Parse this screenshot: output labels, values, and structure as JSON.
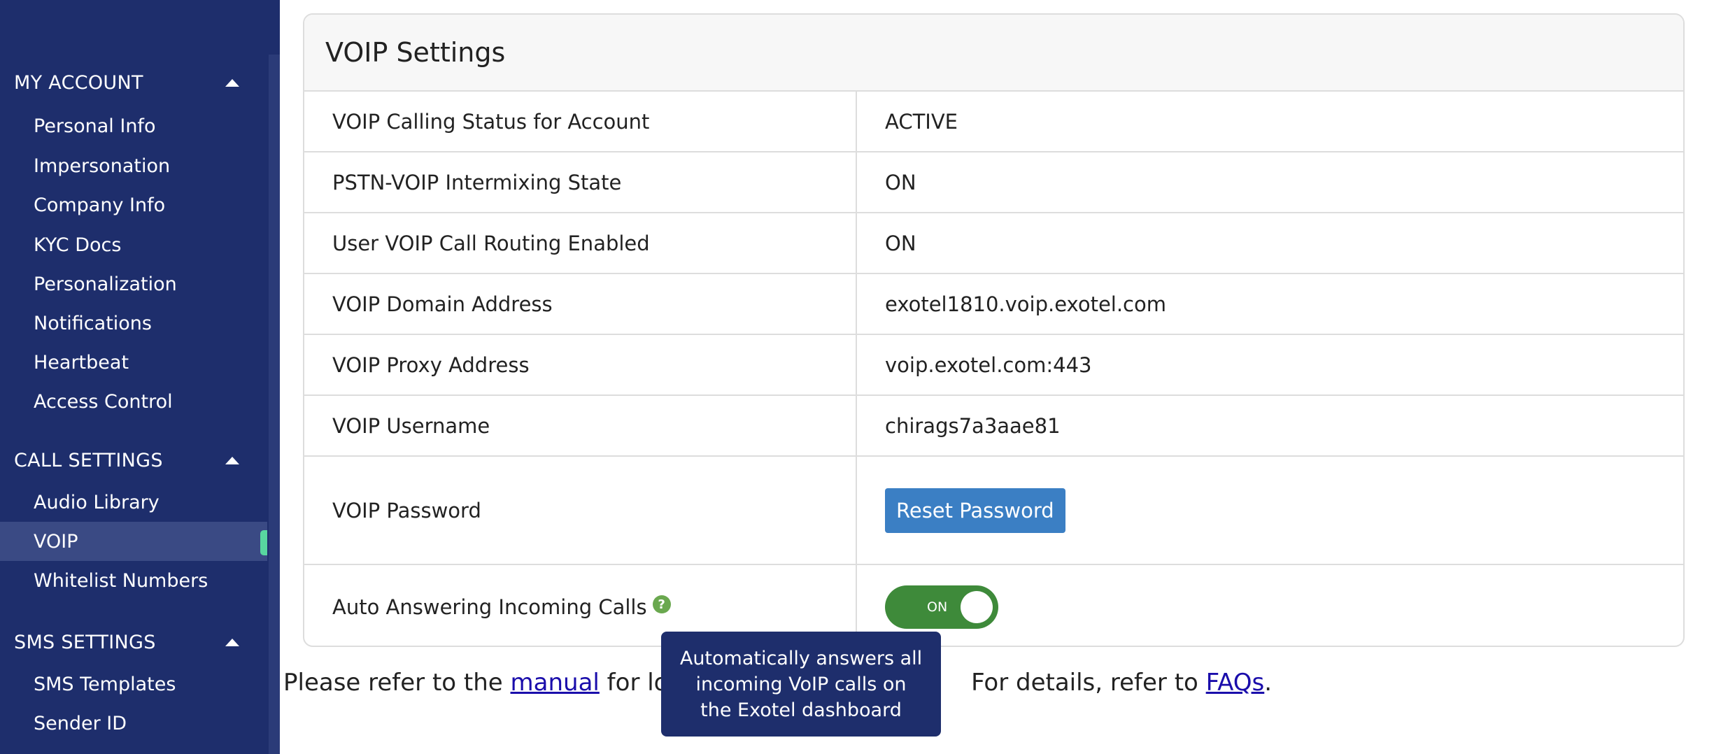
{
  "sidebar": {
    "sections": [
      {
        "title": "MY ACCOUNT",
        "items": [
          "Personal Info",
          "Impersonation",
          "Company Info",
          "KYC Docs",
          "Personalization",
          "Notifications",
          "Heartbeat",
          "Access Control"
        ]
      },
      {
        "title": "CALL SETTINGS",
        "items": [
          "Audio Library",
          "VOIP",
          "Whitelist Numbers"
        ]
      },
      {
        "title": "SMS SETTINGS",
        "items": [
          "SMS Templates",
          "Sender ID"
        ]
      }
    ],
    "active_item": "VOIP"
  },
  "panel": {
    "title": "VOIP Settings",
    "rows": [
      {
        "label": "VOIP Calling Status for Account",
        "value": "ACTIVE"
      },
      {
        "label": "PSTN-VOIP Intermixing State",
        "value": "ON"
      },
      {
        "label": "User VOIP Call Routing Enabled",
        "value": "ON"
      },
      {
        "label": "VOIP Domain Address",
        "value": "exotel1810.voip.exotel.com"
      },
      {
        "label": "VOIP Proxy Address",
        "value": "voip.exotel.com:443"
      },
      {
        "label": "VOIP Username",
        "value": "chirags7a3aae81"
      }
    ],
    "password_row": {
      "label": "VOIP Password",
      "button_label": "Reset Password"
    },
    "auto_answer_row": {
      "label": "Auto Answering Incoming Calls",
      "toggle_label": "ON",
      "help_icon": "?"
    }
  },
  "footer": {
    "prefix": "Please refer to the ",
    "manual_link": "manual",
    "middle": " for login",
    "details_text": "For details, refer to ",
    "faq_link": "FAQs",
    "suffix": "."
  },
  "tooltip": {
    "text": "Automatically answers all incoming VoIP calls on the Exotel dashboard"
  },
  "colors": {
    "sidebar_bg": "#1e2e6c",
    "active_marker": "#58d6a0",
    "button": "#3b7fc4",
    "toggle_on": "#3e8a3a"
  }
}
